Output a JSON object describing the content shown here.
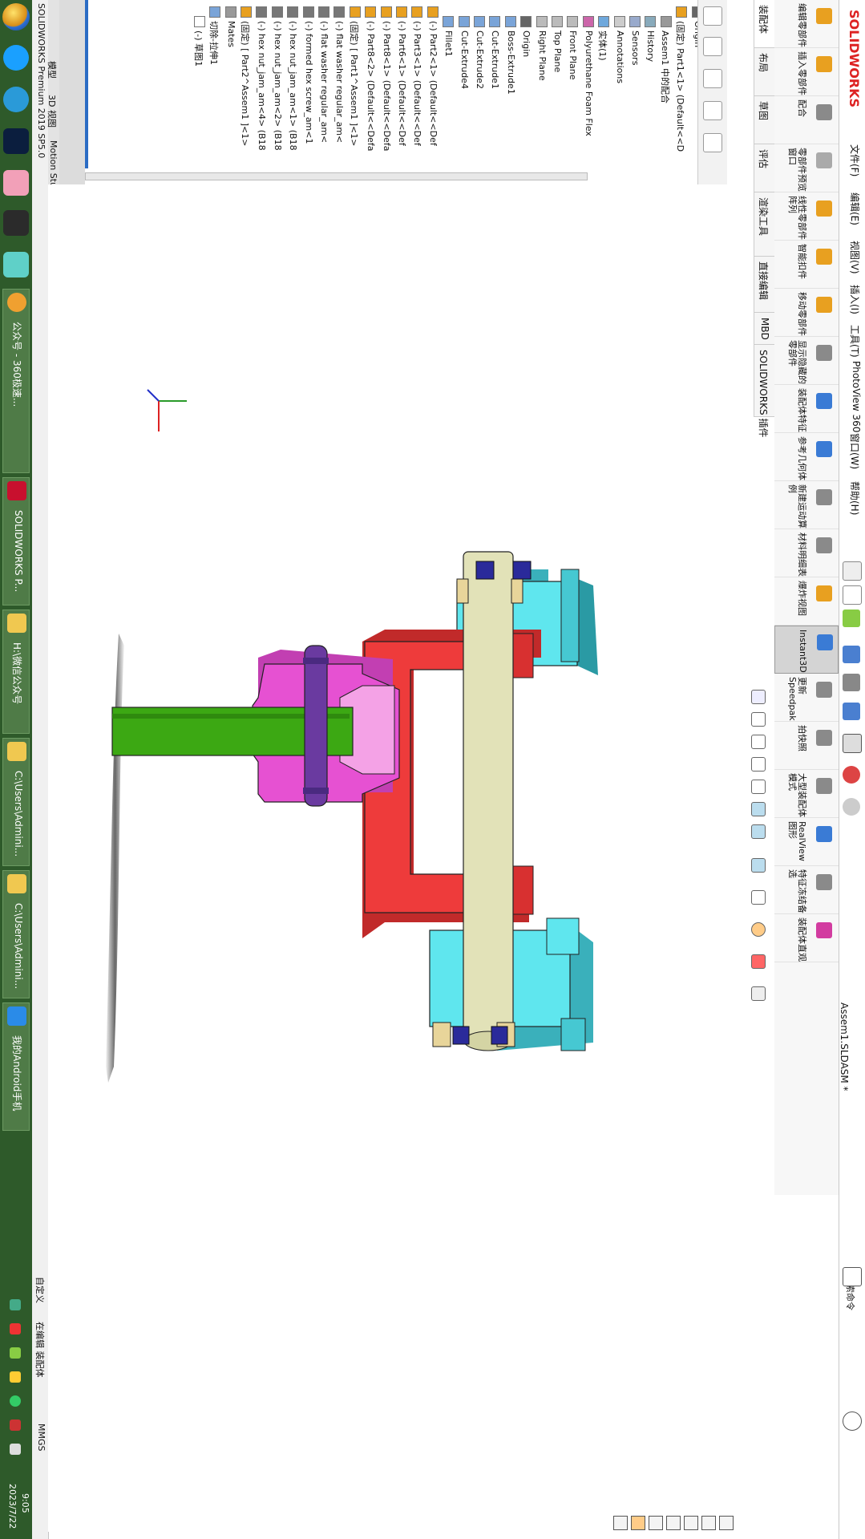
{
  "app": {
    "title": "SOLIDWORKS Premium 2019 SP5.0",
    "document": "Assem1.SLDASM *",
    "brand": "SOLIDWORKS"
  },
  "menu": {
    "items": [
      "文件(F)",
      "编辑(E)",
      "视图(V)",
      "插入(I)",
      "工具(T)",
      "PhotoView 360",
      "窗口(W)",
      "帮助(H)"
    ],
    "search_placeholder": "搜索命令"
  },
  "command_tabs": [
    "装配体",
    "布局",
    "草图",
    "评估",
    "渲染工具",
    "直接编辑",
    "MBD",
    "SOLIDWORKS 插件"
  ],
  "ribbon": [
    {
      "label": "编辑零部件",
      "icon": "edit-component-icon",
      "color": "#e8a020"
    },
    {
      "label": "插入零部件",
      "icon": "insert-component-icon",
      "color": "#e8a020"
    },
    {
      "label": "配合",
      "icon": "mate-icon",
      "color": "#8a8a8a"
    },
    {
      "label": "零部件预览窗口",
      "icon": "preview-window-icon",
      "color": "#aaaaaa"
    },
    {
      "label": "线性零部件阵列",
      "icon": "linear-pattern-icon",
      "color": "#e8a020"
    },
    {
      "label": "智能扣件",
      "icon": "smart-fasteners-icon",
      "color": "#e8a020"
    },
    {
      "label": "移动零部件",
      "icon": "move-component-icon",
      "color": "#e8a020"
    },
    {
      "label": "显示隐藏的零部件",
      "icon": "show-hidden-icon",
      "color": "#8a8a8a"
    },
    {
      "label": "装配体特征",
      "icon": "assembly-features-icon",
      "color": "#3a7bd5"
    },
    {
      "label": "参考几何体",
      "icon": "reference-geometry-icon",
      "color": "#3a7bd5"
    },
    {
      "label": "新建运动算例",
      "icon": "motion-study-icon",
      "color": "#8a8a8a"
    },
    {
      "label": "材料明细表",
      "icon": "bom-icon",
      "color": "#8a8a8a"
    },
    {
      "label": "爆炸视图",
      "icon": "exploded-view-icon",
      "color": "#e8a020"
    },
    {
      "label": "Instant3D",
      "icon": "instant3d-icon",
      "color": "#3a7bd5",
      "active": true
    },
    {
      "label": "更新Speedpak",
      "icon": "speedpak-icon",
      "color": "#8a8a8a"
    },
    {
      "label": "拍快照",
      "icon": "snapshot-icon",
      "color": "#8a8a8a"
    },
    {
      "label": "大型装配体模式",
      "icon": "large-assembly-icon",
      "color": "#8a8a8a"
    },
    {
      "label": "RealView图形",
      "icon": "realview-icon",
      "color": "#3a7bd5"
    },
    {
      "label": "特征冻结备选",
      "icon": "freeze-icon",
      "color": "#8a8a8a"
    },
    {
      "label": "装配体直观",
      "icon": "assembly-visual-icon",
      "color": "#d23ca0"
    }
  ],
  "tree": [
    {
      "text": "Right Plane",
      "icon": "plane-icon",
      "level": 0
    },
    {
      "text": "Origin",
      "icon": "origin-icon",
      "level": 0
    },
    {
      "text": "(固定) Part1<1> (Default<<D",
      "icon": "part-icon",
      "level": 0
    },
    {
      "text": "Assem1 中的配合",
      "icon": "mates-icon",
      "level": 1
    },
    {
      "text": "History",
      "icon": "history-icon",
      "level": 1
    },
    {
      "text": "Sensors",
      "icon": "sensor-icon",
      "level": 1
    },
    {
      "text": "Annotations",
      "icon": "annotation-icon",
      "level": 1
    },
    {
      "text": "实体(1)",
      "icon": "solid-body-icon",
      "level": 1
    },
    {
      "text": "Polyurethane Foam Flex",
      "icon": "material-icon",
      "level": 1
    },
    {
      "text": "Front Plane",
      "icon": "plane-icon",
      "level": 1
    },
    {
      "text": "Top Plane",
      "icon": "plane-icon",
      "level": 1
    },
    {
      "text": "Right Plane",
      "icon": "plane-icon",
      "level": 1
    },
    {
      "text": "Origin",
      "icon": "origin-icon",
      "level": 1
    },
    {
      "text": "Boss-Extrude1",
      "icon": "extrude-icon",
      "level": 1
    },
    {
      "text": "Cut-Extrude1",
      "icon": "cut-icon",
      "level": 1
    },
    {
      "text": "Cut-Extrude2",
      "icon": "cut-icon",
      "level": 1
    },
    {
      "text": "Cut-Extrude4",
      "icon": "cut-icon",
      "level": 1
    },
    {
      "text": "Fillet1",
      "icon": "fillet-icon",
      "level": 1
    },
    {
      "text": "(-) Part2<1> (Default<<Def",
      "icon": "part-icon",
      "level": 0
    },
    {
      "text": "(-) Part3<1> (Default<<Def",
      "icon": "part-icon",
      "level": 0
    },
    {
      "text": "(-) Part6<1> (Default<<Def",
      "icon": "part-icon",
      "level": 0
    },
    {
      "text": "(-) Part8<1> (Default<<Defa",
      "icon": "part-icon",
      "level": 0
    },
    {
      "text": "(-) Part8<2> (Default<<Defa",
      "icon": "part-icon",
      "level": 0
    },
    {
      "text": "(固定) [ Part1^Assem1 ]<1>",
      "icon": "part-icon",
      "level": 0
    },
    {
      "text": "(-) flat washer regular_am<",
      "icon": "fastener-icon",
      "level": 0
    },
    {
      "text": "(-) flat washer regular_am<",
      "icon": "fastener-icon",
      "level": 0
    },
    {
      "text": "(-) formed hex screw_am<1",
      "icon": "fastener-icon",
      "level": 0
    },
    {
      "text": "(-) hex nut_jam_am<1> (B18",
      "icon": "fastener-icon",
      "level": 0
    },
    {
      "text": "(-) hex nut_jam_am<2> (B18",
      "icon": "fastener-icon",
      "level": 0
    },
    {
      "text": "(-) hex nut_jam_am<4> (B18",
      "icon": "fastener-icon",
      "level": 0
    },
    {
      "text": "(固定) [ Part2^Assem1 ]<1>",
      "icon": "part-icon",
      "level": 0
    },
    {
      "text": "Mates",
      "icon": "mates-icon",
      "level": 0
    },
    {
      "text": "切除-拉伸1",
      "icon": "cut-icon",
      "level": 0
    },
    {
      "text": "(-) 草图1",
      "icon": "sketch-icon",
      "level": 1
    }
  ],
  "bottom_tabs": [
    "模型",
    "3D 视图",
    "Motion Study 1"
  ],
  "status": {
    "units": "MMGS",
    "custom": "自定义",
    "editing": "在编辑 装配体",
    "time": "9:05",
    "date": "2023/7/22"
  },
  "taskbar": [
    {
      "label": "公众号 - 360极速...",
      "icon": "browser-icon",
      "color": "#f0a030"
    },
    {
      "label": "SOLIDWORKS P...",
      "icon": "solidworks-icon",
      "color": "#c8102e"
    },
    {
      "label": "H:\\微信公众号",
      "icon": "folder-icon",
      "color": "#f0c850"
    },
    {
      "label": "C:\\Users\\Admini...",
      "icon": "folder-icon",
      "color": "#f0c850"
    },
    {
      "label": "C:\\Users\\Admini...",
      "icon": "folder-icon",
      "color": "#f0c850"
    },
    {
      "label": "我的Android手机",
      "icon": "phone-icon",
      "color": "#2a8be8"
    }
  ],
  "colors": {
    "flange": "#5fe6ee",
    "yoke": "#ee3b3b",
    "hub": "#e651d2",
    "shaft": "#e2e2b8",
    "stem": "#3ca813",
    "bolt": "#6a3aa0",
    "nut": "#2a2a9a",
    "washer": "#e8d59a",
    "accent": "#2b6cc4",
    "taskbar": "#2e5a2a"
  }
}
